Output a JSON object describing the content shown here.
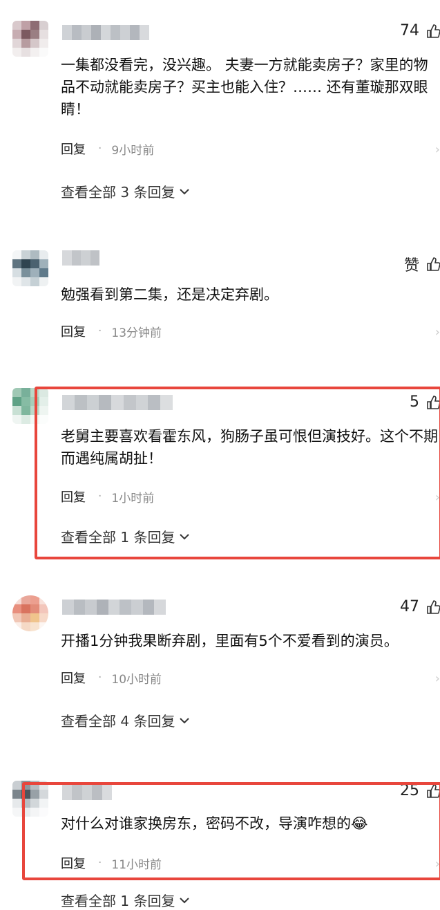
{
  "comments": [
    {
      "likes": "74",
      "text": "一集都没看完，没兴趣。 夫妻一方就能卖房子？家里的物品不动就能卖房子？买主也能入住？…… 还有董璇那双眼睛！",
      "reply_label": "回复",
      "time": "9小时前",
      "view_replies": "查看全部 3 条回复"
    },
    {
      "likes": "赞",
      "text": "勉强看到第二集，还是决定弃剧。",
      "reply_label": "回复",
      "time": "13分钟前",
      "view_replies": ""
    },
    {
      "likes": "5",
      "text": "老舅主要喜欢看霍东风，狗肠子虽可恨但演技好。这个不期而遇纯属胡扯！",
      "reply_label": "回复",
      "time": "1小时前",
      "view_replies": "查看全部 1 条回复"
    },
    {
      "likes": "47",
      "text": "开播1分钟我果断弃剧，里面有5个不爱看到的演员。",
      "reply_label": "回复",
      "time": "10小时前",
      "view_replies": "查看全部 4 条回复"
    },
    {
      "likes": "25",
      "text": "对什么对谁家换房东，密码不改，导演咋想的😂",
      "reply_label": "回复",
      "time": "11小时前",
      "view_replies": "查看全部 1 条回复"
    }
  ],
  "colors": {
    "highlight": "#e8463c",
    "meta_text": "#888888",
    "body_text": "#111111"
  },
  "icons": [
    "like-thumb-icon",
    "chevron-down-icon",
    "chevron-right-icon"
  ]
}
